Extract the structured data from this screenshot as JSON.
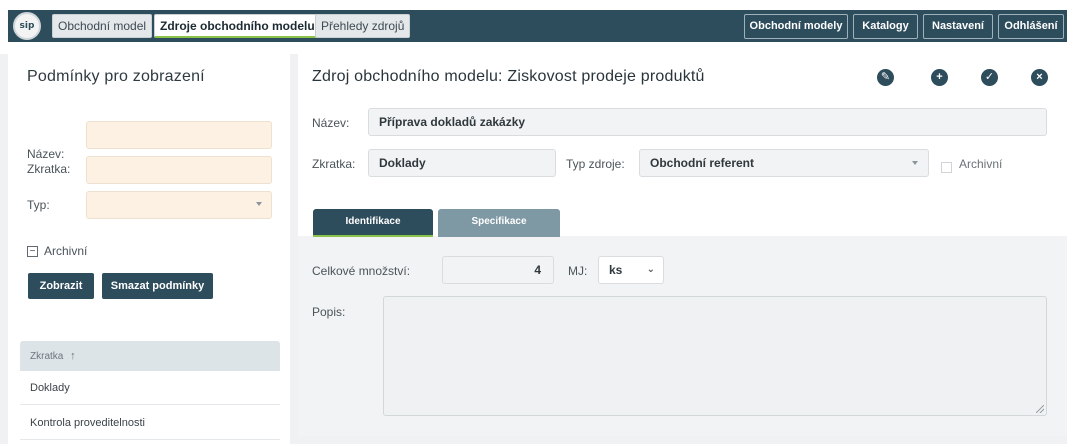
{
  "header": {
    "logo_text": "sip",
    "left_tabs": [
      "Obchodní model",
      "Zdroje obchodního modelu",
      "Přehledy zdrojů"
    ],
    "right_buttons": [
      "Obchodní modely",
      "Katalogy",
      "Nastavení",
      "Odhlášení"
    ]
  },
  "filters": {
    "title": "Podmínky pro zobrazení",
    "name_label": "Název:",
    "abbr_label": "Zkratka:",
    "type_label": "Typ:",
    "name_value": "",
    "abbr_value": "",
    "type_value": "",
    "archived_label": "Archivní",
    "show_button": "Zobrazit",
    "clear_button": "Smazat podmínky",
    "list_header": "Zkratka",
    "sort_icon": "↑",
    "list_items": [
      "Doklady",
      "Kontrola proveditelnosti"
    ]
  },
  "detail": {
    "title": "Zdroj obchodního modelu: Ziskovost prodeje produktů",
    "name_label": "Název:",
    "name_value": "Příprava dokladů zakázky",
    "abbr_label": "Zkratka:",
    "abbr_value": "Doklady",
    "type_label": "Typ zdroje:",
    "type_value": "Obchodní referent",
    "archived_label": "Archivní",
    "tabs": [
      "Identifikace",
      "Specifikace"
    ],
    "quantity_label": "Celkové množství:",
    "quantity_value": "4",
    "unit_label": "MJ:",
    "unit_value": "ks",
    "description_label": "Popis:",
    "description_value": ""
  },
  "colors": {
    "primary": "#2d4c5c",
    "secondary_tab": "#7e98a4",
    "active_accent": "#8bc34a",
    "input_highlight": "#fdf1e4"
  }
}
